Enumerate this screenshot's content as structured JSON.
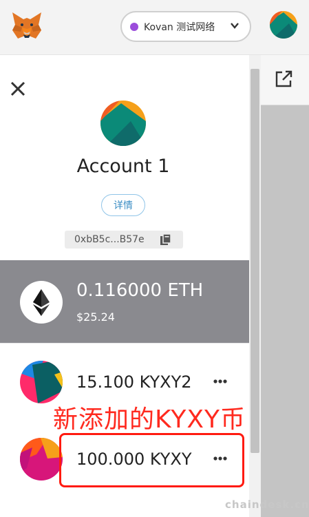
{
  "header": {
    "network_label": "Kovan 测试网络",
    "network_dot_color": "#9b4ddb",
    "logo_icon": "metamask-fox-icon",
    "account_avatar_icon": "account-identicon"
  },
  "account": {
    "name": "Account 1",
    "details_label": "详情",
    "address": "0xbB5c...B57e"
  },
  "assets": [
    {
      "symbol": "ETH",
      "amount_text": "0.116000 ETH",
      "fiat_text": "$25.24",
      "icon": "ethereum-icon"
    },
    {
      "symbol": "KYXY2",
      "amount_text": "15.100 KYXY2",
      "icon": "token-identicon"
    },
    {
      "symbol": "KYXY",
      "amount_text": "100.000 KYXY",
      "icon": "token-identicon"
    }
  ],
  "annotation": {
    "text": "新添加的KYXY币",
    "color": "#ff2a1f"
  },
  "watermark": "chaindesk.cn",
  "colors": {
    "selected_row": "#8a8a8f",
    "details_border": "#8fc4e8",
    "details_text": "#3b8ec4"
  }
}
